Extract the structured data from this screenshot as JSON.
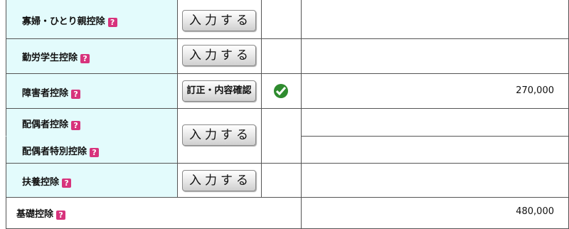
{
  "rows": {
    "widow": {
      "label": "寡婦・ひとり親控除",
      "button": "入力する"
    },
    "working_student": {
      "label": "勤労学生控除",
      "button": "入力する"
    },
    "disability": {
      "label": "障害者控除",
      "button": "訂正・内容確認",
      "amount": "270,000",
      "status_icon": "check-icon"
    },
    "spouse": {
      "label": "配偶者控除"
    },
    "spouse_special": {
      "label": "配偶者特別控除"
    },
    "spouse_button": "入力する",
    "dependent": {
      "label": "扶養控除",
      "button": "入力する"
    },
    "basic": {
      "label": "基礎控除",
      "amount": "480,000"
    }
  },
  "help_glyph": "?",
  "colors": {
    "label_bg": "#e3fbfc",
    "help_icon": "#d7337c",
    "check": "#2e8b2e"
  }
}
